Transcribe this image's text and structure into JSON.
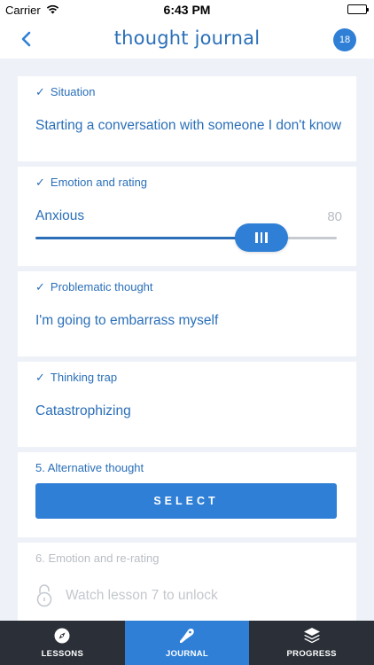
{
  "status_bar": {
    "carrier": "Carrier",
    "time": "6:43 PM",
    "battery_level": 1.0
  },
  "nav": {
    "title": "thought journal",
    "badge_count": "18"
  },
  "cards": {
    "situation": {
      "header": "Situation",
      "check": "✓",
      "value": "Starting a conversation with someone I don't know"
    },
    "emotion": {
      "header": "Emotion and rating",
      "check": "✓",
      "value": "Anxious",
      "rating": 75,
      "rating_max_label": "80"
    },
    "problematic": {
      "header": "Problematic thought",
      "check": "✓",
      "value": "I'm going to embarrass myself"
    },
    "trap": {
      "header": "Thinking trap",
      "check": "✓",
      "value": "Catastrophizing"
    },
    "alternative": {
      "header": "5. Alternative thought",
      "button_label": "SELECT"
    },
    "rerating": {
      "header": "6. Emotion and re-rating",
      "locked_text": "Watch lesson 7 to unlock"
    }
  },
  "tabs": [
    {
      "label": "LESSONS",
      "icon": "compass-icon",
      "active": false
    },
    {
      "label": "JOURNAL",
      "icon": "pen-icon",
      "active": true
    },
    {
      "label": "PROGRESS",
      "icon": "layers-icon",
      "active": false
    }
  ],
  "colors": {
    "accent": "#2f7fd6",
    "text_blue": "#2a6fb8",
    "tab_bar": "#2a2f38",
    "background": "#eef2f8"
  }
}
